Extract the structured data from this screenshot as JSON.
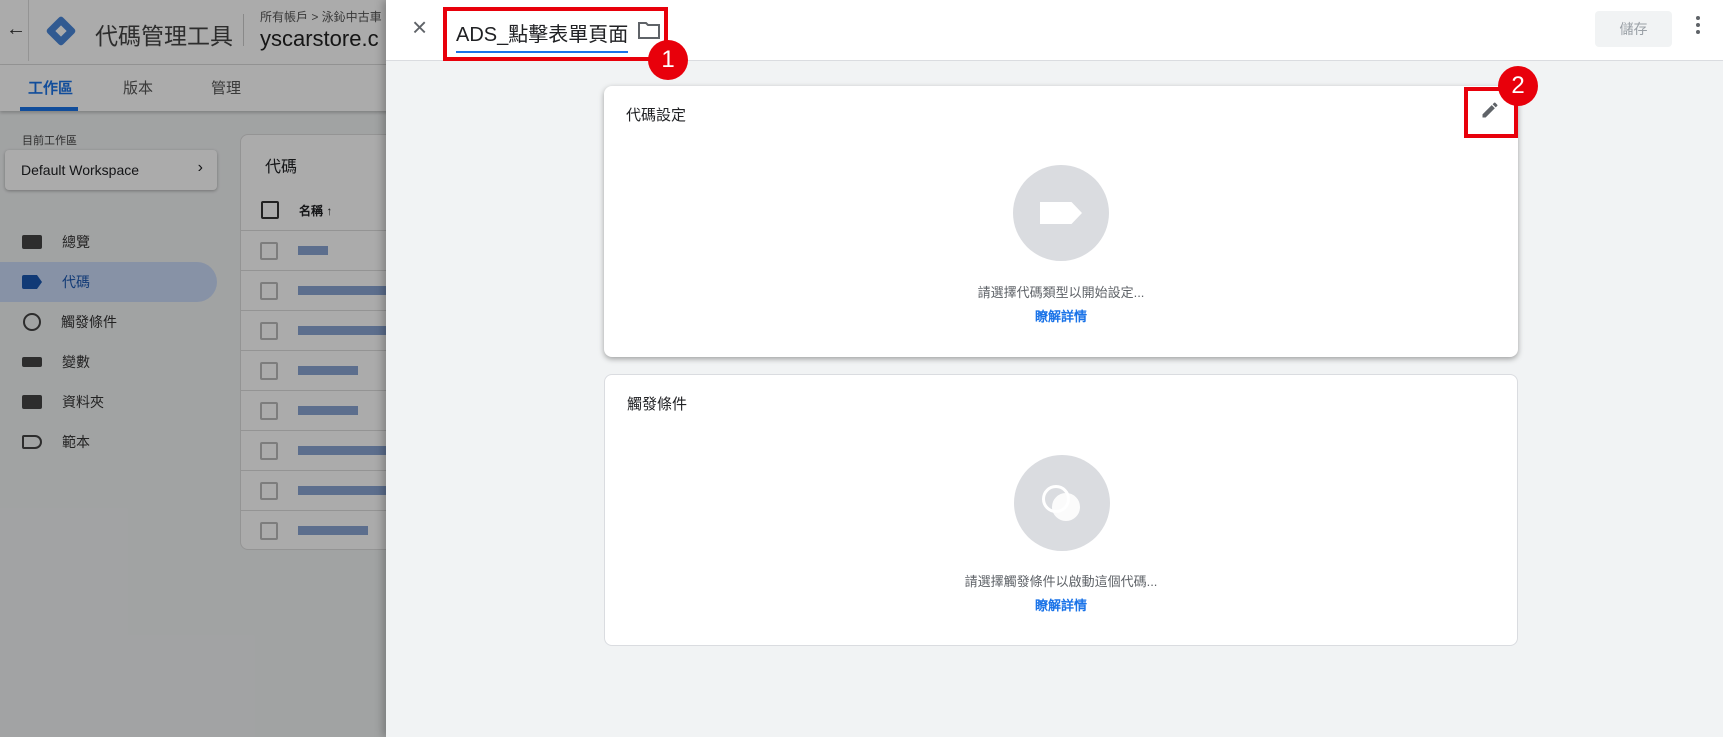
{
  "app": {
    "title": "代碼管理工具",
    "breadcrumb": "所有帳戶 > 泳鈊中古車",
    "container": "yscarstore.c"
  },
  "tabs": [
    {
      "label": "工作區",
      "active": true
    },
    {
      "label": "版本"
    },
    {
      "label": "管理"
    }
  ],
  "workspace": {
    "label": "目前工作區",
    "name": "Default Workspace"
  },
  "nav": [
    {
      "label": "總覽",
      "icon": "overview-icon"
    },
    {
      "label": "代碼",
      "icon": "tag-icon",
      "active": true
    },
    {
      "label": "觸發條件",
      "icon": "trigger-icon"
    },
    {
      "label": "變數",
      "icon": "variable-icon"
    },
    {
      "label": "資料夾",
      "icon": "folder-icon"
    },
    {
      "label": "範本",
      "icon": "template-icon"
    }
  ],
  "tags_table": {
    "title": "代碼",
    "column": "名稱 ↑"
  },
  "panel": {
    "tag_name": "ADS_點擊表單頁面",
    "save_label": "儲存",
    "tag_config": {
      "title": "代碼設定",
      "hint": "請選擇代碼類型以開始設定...",
      "link": "瞭解詳情"
    },
    "triggering": {
      "title": "觸發條件",
      "hint": "請選擇觸發條件以啟動這個代碼...",
      "link": "瞭解詳情"
    }
  },
  "annotations": [
    "1",
    "2"
  ],
  "colors": {
    "accent": "#1a73e8",
    "annotation": "#e8000b"
  }
}
